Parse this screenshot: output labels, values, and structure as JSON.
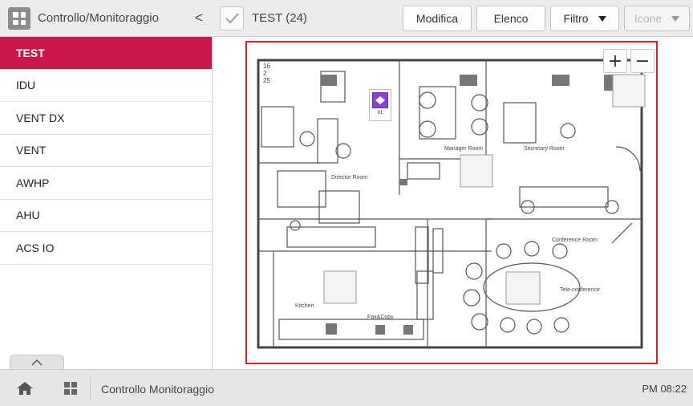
{
  "header": {
    "app_title": "Controllo/Monitoraggio",
    "back_icon": "chevron-left-icon",
    "selection_label": "TEST (24)",
    "buttons": {
      "modifica": "Modifica",
      "elenco": "Elenco",
      "filtro": "Filtro",
      "icone": "Icone"
    }
  },
  "sidebar": {
    "items": [
      {
        "label": "TEST",
        "active": true
      },
      {
        "label": "IDU",
        "active": false
      },
      {
        "label": "VENT DX",
        "active": false
      },
      {
        "label": "VENT",
        "active": false
      },
      {
        "label": "AWHP",
        "active": false
      },
      {
        "label": "AHU",
        "active": false
      },
      {
        "label": "ACS IO",
        "active": false
      }
    ]
  },
  "map": {
    "zoom_in": "+",
    "zoom_out": "−",
    "rooms": {
      "director": "Director Room",
      "manager": "Manager Room",
      "secretary": "Secretary Room",
      "conference": "Conference Room",
      "kitchen": "Kitchen",
      "fax": "Fax&Copy",
      "teleconference": "Tele-conference"
    },
    "device_label": "01",
    "numbers": [
      "16",
      "2",
      "25"
    ]
  },
  "footer": {
    "title": "Controllo Monitoraggio",
    "clock": "PM 08:22"
  },
  "colors": {
    "accent": "#c8194a",
    "frame": "#e01b24",
    "device": "#8b44cc"
  }
}
